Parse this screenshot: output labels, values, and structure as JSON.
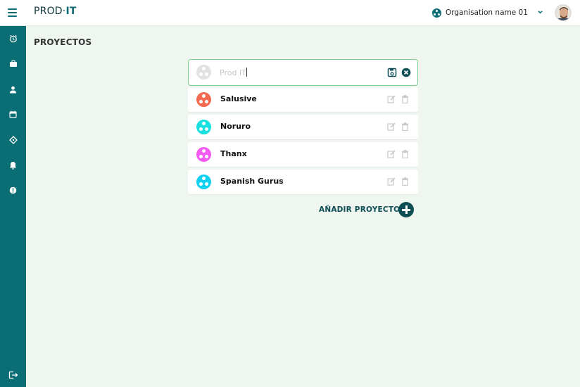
{
  "app": {
    "logo_text": "PROD",
    "logo_accent": "IT"
  },
  "header": {
    "organisation_name": "Organisation name 01"
  },
  "page": {
    "title": "PROYECTOS"
  },
  "editor": {
    "value": "",
    "placeholder": "Prod IT"
  },
  "projects": [
    {
      "name": "Salusive",
      "color": "#f26a4f"
    },
    {
      "name": "Noruro",
      "color": "#19e0e0"
    },
    {
      "name": "Thanx",
      "color": "#f25af2"
    },
    {
      "name": "Spanish Gurus",
      "color": "#12d0f0"
    }
  ],
  "actions": {
    "add_project_label": "AÑADIR PROYECTO"
  },
  "colors": {
    "brand": "#0b6e74",
    "background": "#eff6ef",
    "editor_border": "#7dd08a",
    "add_button": "#0e4f55"
  },
  "sidebar_icons": [
    "alarm-clock-icon",
    "briefcase-icon",
    "user-icon",
    "calendar-icon",
    "tag-icon",
    "bell-icon",
    "info-icon",
    "logout-icon"
  ]
}
